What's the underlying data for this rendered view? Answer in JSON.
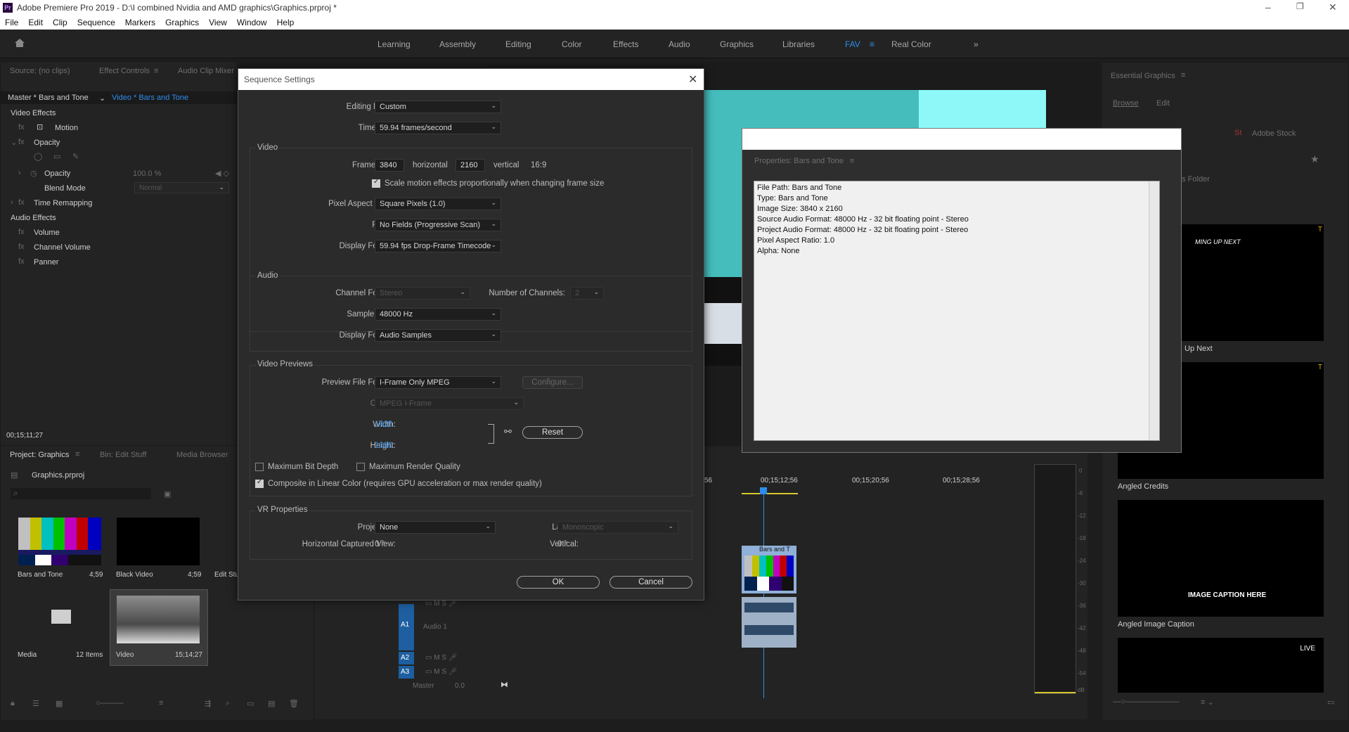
{
  "window": {
    "app_icon": "Pr",
    "title": "Adobe Premiere Pro 2019 - D:\\I combined Nvidia and AMD graphics\\Graphics.prproj *"
  },
  "menu": [
    "File",
    "Edit",
    "Clip",
    "Sequence",
    "Markers",
    "Graphics",
    "View",
    "Window",
    "Help"
  ],
  "workspaces": [
    "Learning",
    "Assembly",
    "Editing",
    "Color",
    "Effects",
    "Audio",
    "Graphics",
    "Libraries",
    "FAV",
    "Real Color"
  ],
  "workspace_active": "FAV",
  "effect_controls": {
    "tabs": [
      "Source: (no clips)",
      "Effect Controls",
      "Audio Clip Mixer"
    ],
    "master_clip": "Master * Bars and Tone",
    "sequence_clip": "Video * Bars and Tone",
    "video_effects_label": "Video Effects",
    "motion": "Motion",
    "opacity": "Opacity",
    "opacity_param": "Opacity",
    "opacity_value": "100.0 %",
    "blend_mode": "Blend Mode",
    "blend_value": "Normal",
    "time_remapping": "Time Remapping",
    "audio_effects_label": "Audio Effects",
    "volume": "Volume",
    "channel_volume": "Channel Volume",
    "panner": "Panner",
    "timecode": "00;15;11;27"
  },
  "project": {
    "tabs": [
      "Project: Graphics",
      "Bin: Edit Stuff",
      "Media Browser"
    ],
    "file": "Graphics.prproj",
    "items": [
      {
        "name": "Bars and Tone",
        "duration": "4;59"
      },
      {
        "name": "Black Video",
        "duration": "4;59"
      },
      {
        "name": "Edit Stuff",
        "duration": ""
      },
      {
        "name": "Media",
        "duration": "12 Items"
      },
      {
        "name": "Video",
        "duration": "15;14;27"
      }
    ]
  },
  "dialog": {
    "title": "Sequence Settings",
    "editing_mode_label": "Editing Mode:",
    "editing_mode": "Custom",
    "timebase_label": "Timebase:",
    "timebase": "59.94  frames/second",
    "video_group": "Video",
    "frame_size_label": "Frame Size:",
    "frame_w": "3840",
    "horizontal": "horizontal",
    "frame_h": "2160",
    "vertical": "vertical",
    "aspect": "16:9",
    "scale_motion": "Scale motion effects proportionally when changing frame size",
    "par_label": "Pixel Aspect Ratio:",
    "par": "Square Pixels (1.0)",
    "fields_label": "Fields:",
    "fields": "No Fields (Progressive Scan)",
    "display_format_label": "Display Format:",
    "display_format": "59.94 fps Drop-Frame Timecode",
    "audio_group": "Audio",
    "channel_format_label": "Channel Format:",
    "channel_format": "Stereo",
    "num_channels_label": "Number of Channels:",
    "num_channels": "2",
    "sample_rate_label": "Sample Rate:",
    "sample_rate": "48000 Hz",
    "audio_display_format_label": "Display Format:",
    "audio_display_format": "Audio Samples",
    "previews_group": "Video Previews",
    "preview_format_label": "Preview File Format:",
    "preview_format": "I-Frame Only MPEG",
    "configure": "Configure...",
    "codec_label": "Codec:",
    "codec": "MPEG I-Frame",
    "width_label": "Width:",
    "width": "1920",
    "height_label": "Height:",
    "height": "1080",
    "reset": "Reset",
    "max_bit_depth": "Maximum Bit Depth",
    "max_render_quality": "Maximum Render Quality",
    "composite_linear": "Composite in Linear Color (requires GPU acceleration or max render quality)",
    "vr_group": "VR Properties",
    "projection_label": "Projection:",
    "projection": "None",
    "layout_label": "Layout:",
    "layout": "Monoscopic",
    "hcv_label": "Horizontal Captured View:",
    "hcv": "0 °",
    "vertical_label": "Vertical:",
    "vertical_val": "0 °",
    "ok": "OK",
    "cancel": "Cancel"
  },
  "properties": {
    "title": "Properties: Bars and Tone",
    "lines": [
      "File Path: Bars and Tone",
      "Type: Bars and Tone",
      "Image Size: 3840 x 2160",
      "Source Audio Format: 48000 Hz - 32 bit floating point - Stereo",
      "Project Audio Format: 48000 Hz - 32 bit floating point - Stereo",
      "Pixel Aspect Ratio: 1.0",
      "Alpha: None"
    ]
  },
  "timeline": {
    "timecodes": [
      "56",
      "00;15;12;56",
      "00;15;20;56",
      "00;15;28;56"
    ],
    "clip_label": "Bars and T",
    "tracks": [
      "A1",
      "A2",
      "A3"
    ],
    "audio1": "Audio 1",
    "master": "Master",
    "master_val": "0.0",
    "meter_scale": [
      "0",
      "-6",
      "-12",
      "-18",
      "-24",
      "-30",
      "-36",
      "-42",
      "-48",
      "-54",
      "dB"
    ]
  },
  "essential_graphics": {
    "title": "Essential Graphics",
    "tabs": [
      "Browse",
      "Edit"
    ],
    "stock": "Adobe Stock",
    "folder": "es Folder",
    "templates": [
      {
        "name": "Up Next",
        "thumb_text": "MING UP NEXT"
      },
      {
        "name": "Angled Credits",
        "thumb_text": ""
      },
      {
        "name": "Angled Image Caption",
        "thumb_text": "IMAGE CAPTION HERE"
      },
      {
        "name": "",
        "thumb_text": "LIVE"
      }
    ]
  },
  "colors": {
    "accent": "#2d8ceb",
    "teal": "#45bdbd",
    "cyan": "#8ef8f8"
  }
}
